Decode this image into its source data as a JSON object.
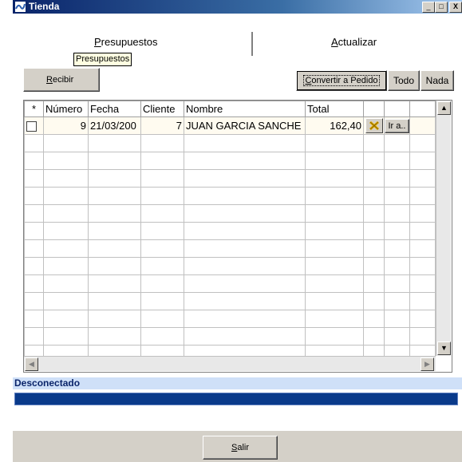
{
  "window": {
    "title": "Tienda",
    "min": "_",
    "max": "□",
    "close": "X"
  },
  "tabs": [
    {
      "label": "Presupuestos",
      "accel": "P",
      "rest": "resupuestos"
    },
    {
      "label": "Actualizar",
      "accel": "A",
      "rest": "ctualizar"
    }
  ],
  "tooltip": "Presupuestos",
  "toolbar": {
    "recibir": {
      "accel": "R",
      "rest": "ecibir"
    },
    "convertir": {
      "accel": "C",
      "rest": "onvertir a Pedido"
    },
    "todo": "Todo",
    "nada": "Nada"
  },
  "grid": {
    "headers": [
      "*",
      "Número",
      "Fecha",
      "Cliente",
      "Nombre",
      "Total",
      "",
      "",
      ""
    ],
    "rows": [
      {
        "numero": "9",
        "fecha": "21/03/200",
        "cliente": "7",
        "nombre": "JUAN GARCIA SANCHE",
        "total": "162,40",
        "ir": "Ir a.."
      }
    ]
  },
  "status": "Desconectado",
  "salir": {
    "accel": "S",
    "rest": "alir"
  }
}
